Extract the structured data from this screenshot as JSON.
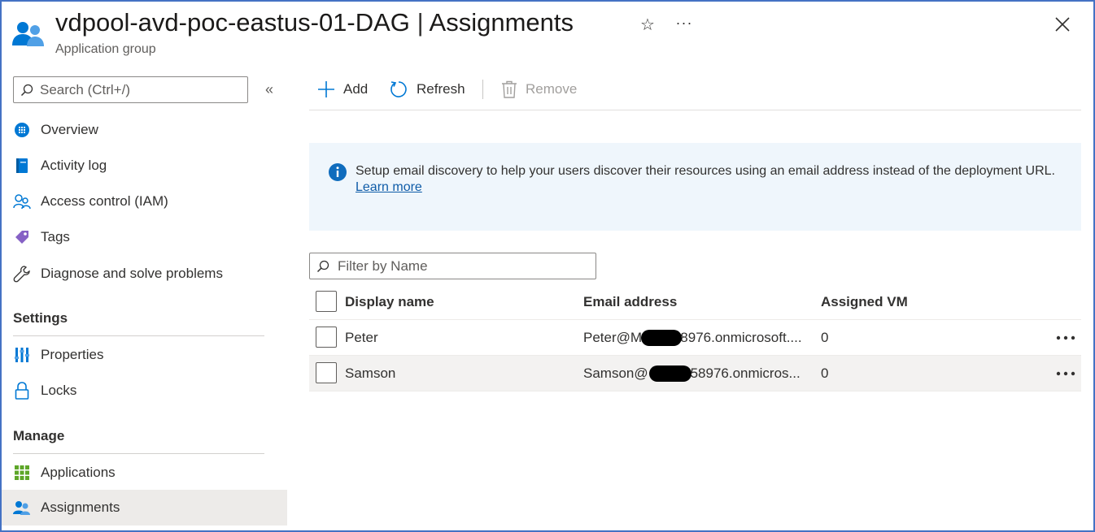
{
  "header": {
    "resource_name": "vdpool-avd-poc-eastus-01-DAG",
    "separator": "|",
    "blade_name": "Assignments",
    "subtitle": "Application group",
    "favorite_glyph": "☆",
    "more_glyph": "···"
  },
  "sidebar": {
    "search_placeholder": "Search (Ctrl+/)",
    "collapse_glyph": "«",
    "items": [
      {
        "label": "Overview",
        "icon": "overview-icon"
      },
      {
        "label": "Activity log",
        "icon": "activity-log-icon"
      },
      {
        "label": "Access control (IAM)",
        "icon": "iam-icon"
      },
      {
        "label": "Tags",
        "icon": "tag-icon"
      },
      {
        "label": "Diagnose and solve problems",
        "icon": "wrench-icon"
      }
    ],
    "sections": [
      {
        "title": "Settings",
        "items": [
          {
            "label": "Properties",
            "icon": "properties-icon"
          },
          {
            "label": "Locks",
            "icon": "lock-icon"
          }
        ]
      },
      {
        "title": "Manage",
        "items": [
          {
            "label": "Applications",
            "icon": "applications-icon"
          },
          {
            "label": "Assignments",
            "icon": "assignments-icon",
            "active": true
          }
        ]
      }
    ]
  },
  "toolbar": {
    "add_label": "Add",
    "refresh_label": "Refresh",
    "remove_label": "Remove"
  },
  "banner": {
    "message": "Setup email discovery to help your users discover their resources using an email address instead of the deployment URL.",
    "link_label": "Learn more "
  },
  "filter": {
    "placeholder": "Filter by Name"
  },
  "table": {
    "columns": [
      "Display name",
      "Email address",
      "Assigned VM"
    ],
    "rows": [
      {
        "name": "Peter",
        "email": "Peter@M        58976.onmicrosoft....",
        "assigned_vm": "0"
      },
      {
        "name": "Samson",
        "email": "Samson@         758976.onmicros...",
        "assigned_vm": "0"
      }
    ]
  },
  "colors": {
    "accent": "#0078d4",
    "frame_border": "#4472c4",
    "banner_bg": "#eff6fc",
    "active_nav_bg": "#edebe9"
  }
}
